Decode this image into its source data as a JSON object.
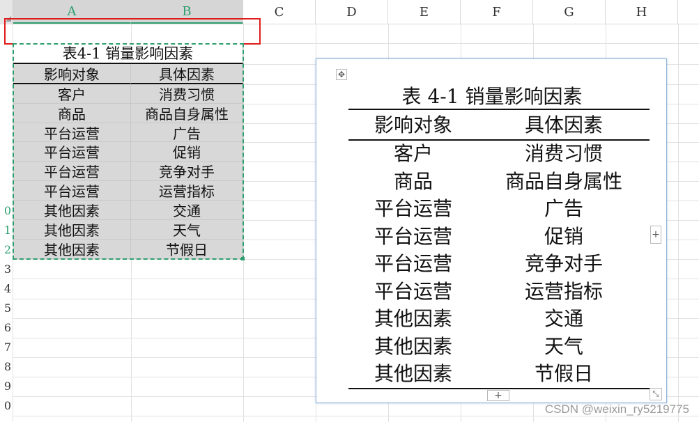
{
  "columns": [
    "A",
    "B",
    "C",
    "D",
    "E",
    "F",
    "G",
    "H"
  ],
  "row_numbers": [
    "0",
    "1",
    "2",
    "3",
    "4",
    "5",
    "6",
    "7",
    "8",
    "9",
    "0"
  ],
  "sheet_title": "表4-1 销量影响因素",
  "sheet_header": [
    "影响对象",
    "具体因素"
  ],
  "sheet_rows": [
    [
      "客户",
      "消费习惯"
    ],
    [
      "商品",
      "商品自身属性"
    ],
    [
      "平台运营",
      "广告"
    ],
    [
      "平台运营",
      "促销"
    ],
    [
      "平台运营",
      "竞争对手"
    ],
    [
      "平台运营",
      "运营指标"
    ],
    [
      "其他因素",
      "交通"
    ],
    [
      "其他因素",
      "天气"
    ],
    [
      "其他因素",
      "节假日"
    ]
  ],
  "float_table": {
    "title": "表 4-1  销量影响因素",
    "header": [
      "影响对象",
      "具体因素"
    ],
    "rows": [
      [
        "客户",
        "消费习惯"
      ],
      [
        "商品",
        "商品自身属性"
      ],
      [
        "平台运营",
        "广告"
      ],
      [
        "平台运营",
        "促销"
      ],
      [
        "平台运营",
        "竞争对手"
      ],
      [
        "平台运营",
        "运营指标"
      ],
      [
        "其他因素",
        "交通"
      ],
      [
        "其他因素",
        "天气"
      ],
      [
        "其他因素",
        "节假日"
      ]
    ]
  },
  "icons": {
    "move": "✥",
    "plus": "+",
    "resize": "⤡"
  },
  "watermark": "CSDN @weixin_ry5219775",
  "colors": {
    "selection_green": "#2e9e6f",
    "annotation_red": "#e01b1b",
    "cell_gray": "#d8d8d8"
  }
}
